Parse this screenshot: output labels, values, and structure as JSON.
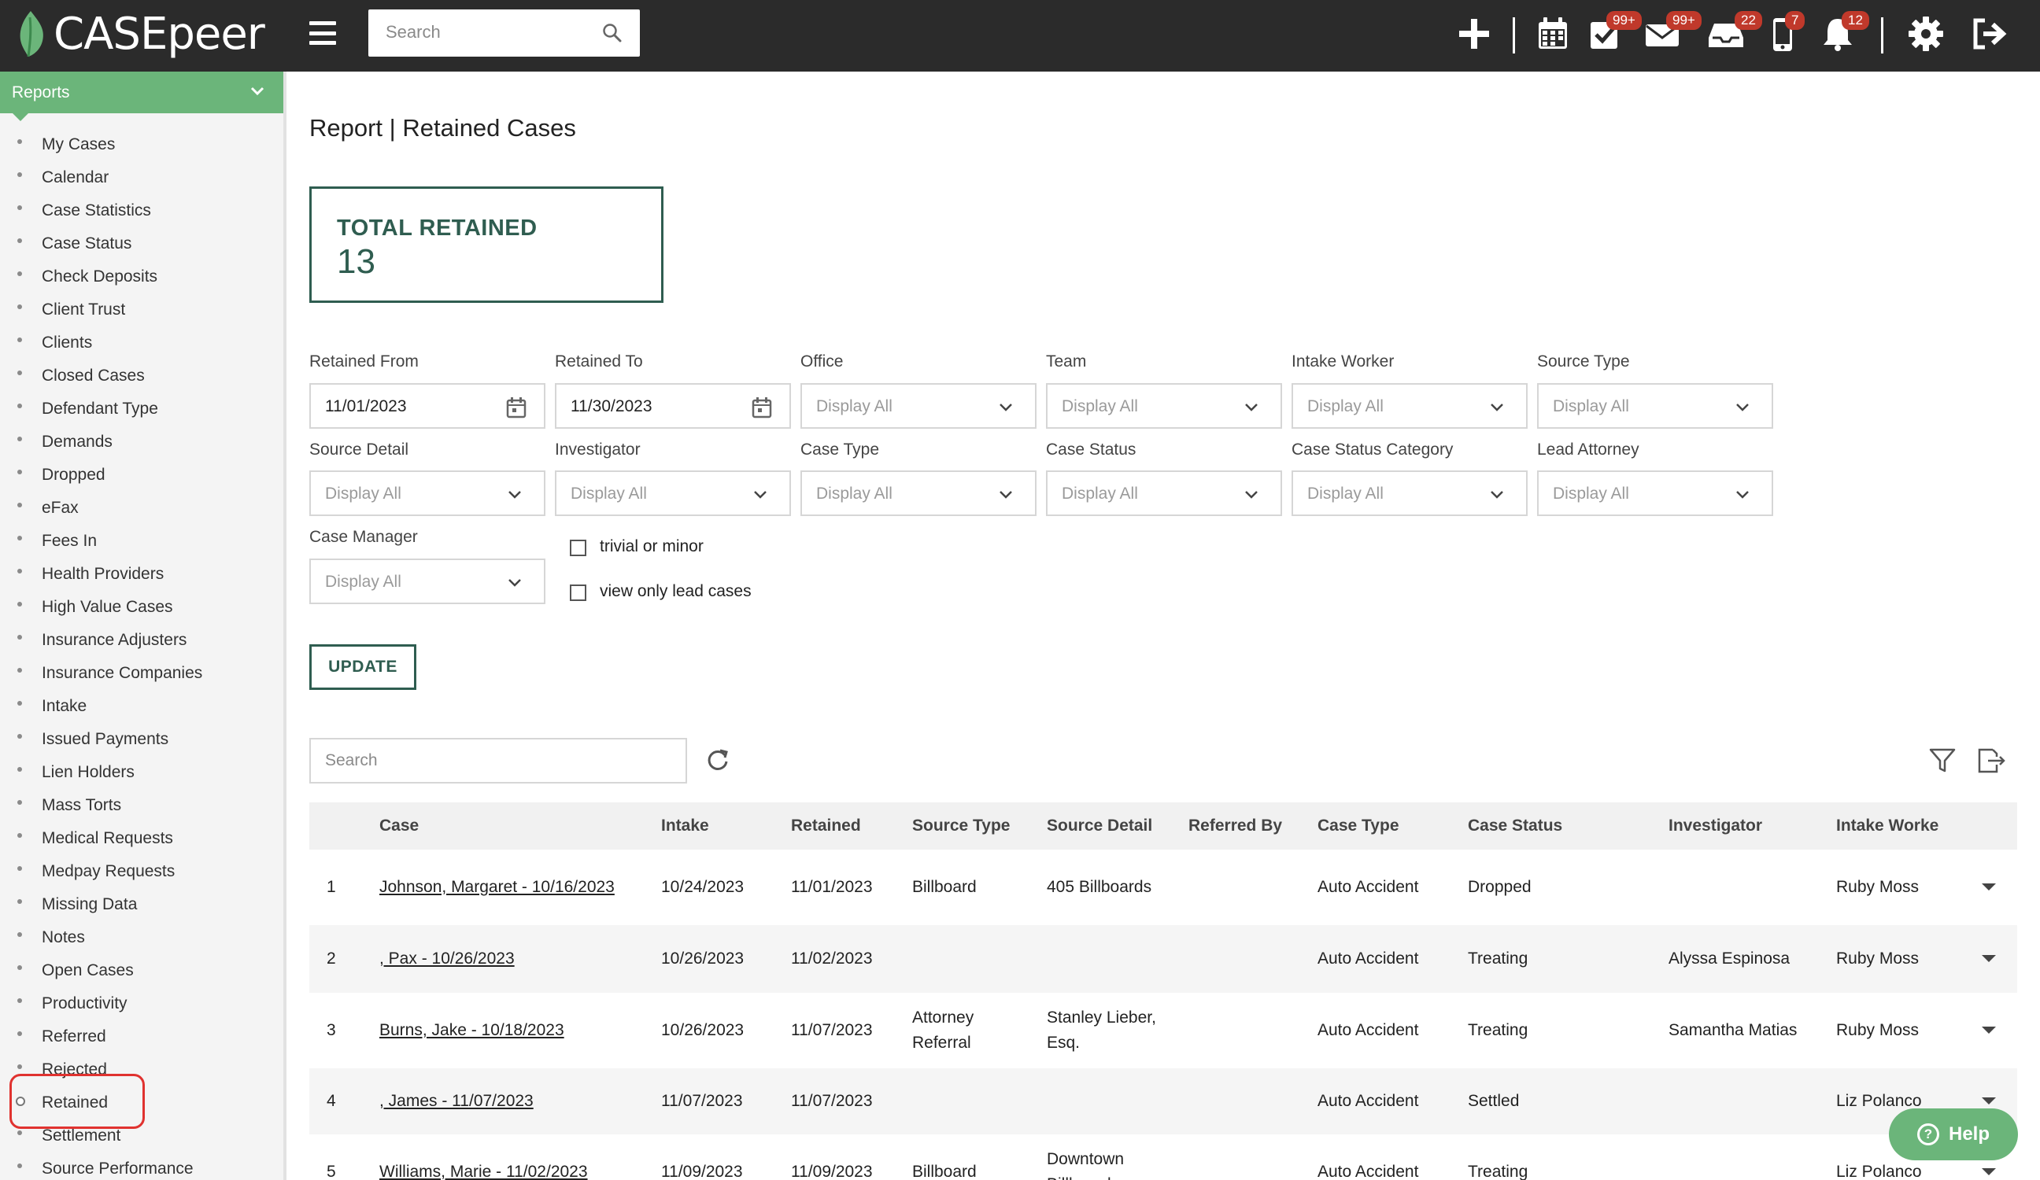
{
  "app": {
    "logo_text": "CASEpeer",
    "search_placeholder": "Search",
    "brand_color": "#6bb57a",
    "accent_color": "#2f5d50",
    "badges": {
      "tasks": "99+",
      "mail": "99+",
      "inbox": "22",
      "phone": "7",
      "notifications": "12"
    }
  },
  "sidebar": {
    "header": "Reports",
    "items": [
      "My Cases",
      "Calendar",
      "Case Statistics",
      "Case Status",
      "Check Deposits",
      "Client Trust",
      "Clients",
      "Closed Cases",
      "Defendant Type",
      "Demands",
      "Dropped",
      "eFax",
      "Fees In",
      "Health Providers",
      "High Value Cases",
      "Insurance Adjusters",
      "Insurance Companies",
      "Intake",
      "Issued Payments",
      "Lien Holders",
      "Mass Torts",
      "Medical Requests",
      "Medpay Requests",
      "Missing Data",
      "Notes",
      "Open Cases",
      "Productivity",
      "Referred",
      "Rejected",
      "Retained",
      "Settlement",
      "Source Performance"
    ],
    "active": "Retained"
  },
  "page": {
    "title": "Report | Retained Cases",
    "total_label": "TOTAL RETAINED",
    "total_value": "13"
  },
  "filters": {
    "retained_from": {
      "label": "Retained From",
      "value": "11/01/2023"
    },
    "retained_to": {
      "label": "Retained To",
      "value": "11/30/2023"
    },
    "office": {
      "label": "Office",
      "value": "Display All"
    },
    "team": {
      "label": "Team",
      "value": "Display All"
    },
    "intake_worker": {
      "label": "Intake Worker",
      "value": "Display All"
    },
    "source_type": {
      "label": "Source Type",
      "value": "Display All"
    },
    "source_detail": {
      "label": "Source Detail",
      "value": "Display All"
    },
    "investigator": {
      "label": "Investigator",
      "value": "Display All"
    },
    "case_type": {
      "label": "Case Type",
      "value": "Display All"
    },
    "case_status": {
      "label": "Case Status",
      "value": "Display All"
    },
    "case_status_category": {
      "label": "Case Status Category",
      "value": "Display All"
    },
    "lead_attorney": {
      "label": "Lead Attorney",
      "value": "Display All"
    },
    "case_manager": {
      "label": "Case Manager",
      "value": "Display All"
    },
    "checkbox_trivial": "trivial or minor",
    "checkbox_lead": "view only lead cases",
    "update_label": "UPDATE"
  },
  "table": {
    "search_placeholder": "Search",
    "headers": [
      "",
      "Case",
      "Intake",
      "Retained",
      "Source Type",
      "Source Detail",
      "Referred By",
      "Case Type",
      "Case Status",
      "Investigator",
      "Intake Worke",
      ""
    ],
    "rows": [
      {
        "n": "1",
        "case": "Johnson, Margaret - 10/16/2023",
        "intake": "10/24/2023",
        "retained": "11/01/2023",
        "source_type": "Billboard",
        "source_detail": "405 Billboards",
        "referred_by": "",
        "case_type": "Auto Accident",
        "status": "Dropped",
        "investigator": "",
        "intake_worker": "Ruby Moss"
      },
      {
        "n": "2",
        "case": ", Pax - 10/26/2023",
        "intake": "10/26/2023",
        "retained": "11/02/2023",
        "source_type": "",
        "source_detail": "",
        "referred_by": "",
        "case_type": "Auto Accident",
        "status": "Treating",
        "investigator": "Alyssa Espinosa",
        "intake_worker": "Ruby Moss"
      },
      {
        "n": "3",
        "case": "Burns, Jake - 10/18/2023",
        "intake": "10/26/2023",
        "retained": "11/07/2023",
        "source_type": "Attorney Referral",
        "source_detail": "Stanley Lieber, Esq.",
        "referred_by": "",
        "case_type": "Auto Accident",
        "status": "Treating",
        "investigator": "Samantha Matias",
        "intake_worker": "Ruby Moss"
      },
      {
        "n": "4",
        "case": ", James - 11/07/2023",
        "intake": "11/07/2023",
        "retained": "11/07/2023",
        "source_type": "",
        "source_detail": "",
        "referred_by": "",
        "case_type": "Auto Accident",
        "status": "Settled",
        "investigator": "",
        "intake_worker": "Liz Polanco"
      },
      {
        "n": "5",
        "case": "Williams, Marie - 11/02/2023",
        "intake": "11/09/2023",
        "retained": "11/09/2023",
        "source_type": "Billboard",
        "source_detail": "Downtown Billboards",
        "referred_by": "",
        "case_type": "Auto Accident",
        "status": "Treating",
        "investigator": "",
        "intake_worker": "Liz Polanco"
      }
    ]
  },
  "help_label": "Help"
}
